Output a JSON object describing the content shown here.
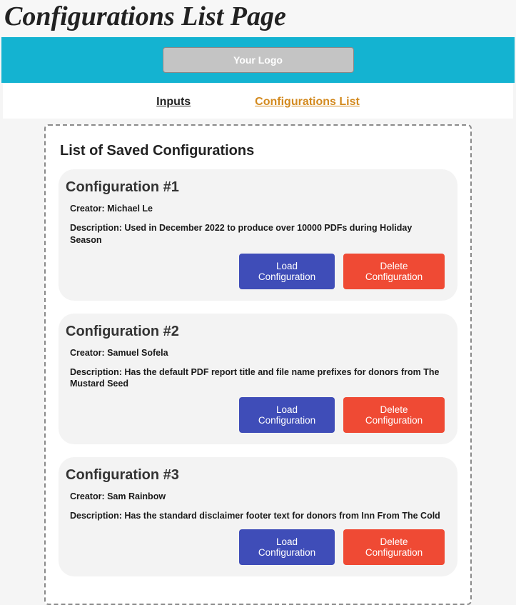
{
  "page_title": "Configurations List Page",
  "logo_text": "Your Logo",
  "tabs": {
    "inputs": "Inputs",
    "configs": "Configurations List"
  },
  "list_heading": "List of Saved Configurations",
  "buttons": {
    "load": "Load Configuration",
    "delete": "Delete Configuration"
  },
  "configs": [
    {
      "title": "Configuration #1",
      "creator": "Creator: Michael Le",
      "description": "Description: Used in December 2022 to produce over 10000 PDFs during Holiday Season"
    },
    {
      "title": "Configuration #2",
      "creator": "Creator: Samuel Sofela",
      "description": "Description: Has the default PDF report title and  file name prefixes for donors from The Mustard Seed"
    },
    {
      "title": "Configuration #3",
      "creator": "Creator: Sam Rainbow",
      "description": "Description: Has the standard disclaimer footer text for donors from Inn From The Cold"
    }
  ]
}
